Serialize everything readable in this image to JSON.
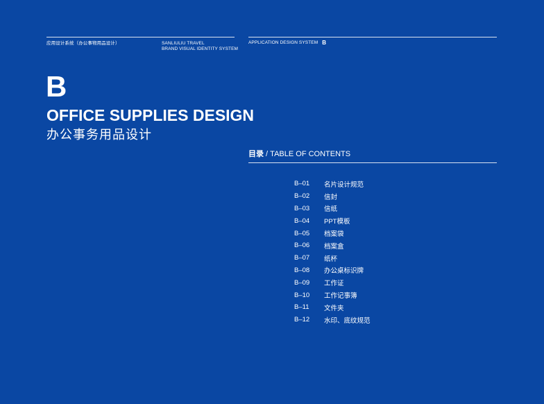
{
  "header": {
    "left_label": "应用设计系统（办公事物用品设计）",
    "brand_line1": "SANLIULIU TRAVEL",
    "brand_line2": "BRAND VISUAL IDENTITY SYSTEM",
    "system_label": "APPLICATION DESIGN SYSTEM",
    "system_letter": "B"
  },
  "section": {
    "letter": "B",
    "title_en": "OFFICE SUPPLIES DESIGN",
    "title_cn": "办公事务用品设计"
  },
  "toc": {
    "heading_cn": "目录",
    "heading_sep": " / ",
    "heading_en": "TABLE OF CONTENTS",
    "items": [
      {
        "code": "B–01",
        "label": "名片设计规范"
      },
      {
        "code": "B–02",
        "label": "信封"
      },
      {
        "code": "B–03",
        "label": "信纸"
      },
      {
        "code": "B–04",
        "label": "PPT模板"
      },
      {
        "code": "B–05",
        "label": "档案袋"
      },
      {
        "code": "B–06",
        "label": "档案盒"
      },
      {
        "code": "B–07",
        "label": "纸杯"
      },
      {
        "code": "B–08",
        "label": "办公桌标识牌"
      },
      {
        "code": "B–09",
        "label": "工作证"
      },
      {
        "code": "B–10",
        "label": "工作记事簿"
      },
      {
        "code": "B–11",
        "label": "文件夹"
      },
      {
        "code": "B–12",
        "label": "水印、底纹规范"
      }
    ]
  },
  "colors": {
    "background": "#0a47a3",
    "text": "#ffffff"
  }
}
